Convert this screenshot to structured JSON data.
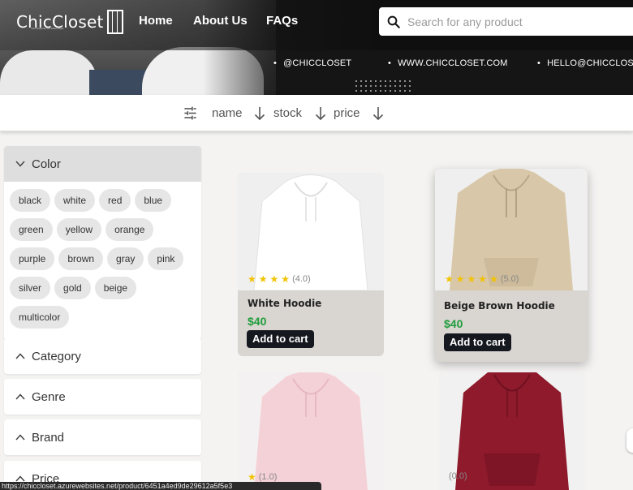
{
  "header": {
    "logo_text": "ChicCloset",
    "logo_tagline": "Your Emporium of Street Style",
    "nav": [
      "Home",
      "About Us",
      "FAQs"
    ],
    "search_placeholder": "Search for any product",
    "contacts": [
      "@CHICCLOSET",
      "WWW.CHICCLOSET.COM",
      "HELLO@CHICCLOSET"
    ]
  },
  "sort_bar": {
    "icon": "tune-icon",
    "fields": [
      {
        "label": "name",
        "icon": "arrow-down-icon"
      },
      {
        "label": "stock",
        "icon": "arrow-down-icon"
      },
      {
        "label": "price",
        "icon": "arrow-down-icon"
      }
    ]
  },
  "filters": {
    "color": {
      "title": "Color",
      "expanded": true,
      "options": [
        "black",
        "white",
        "red",
        "blue",
        "green",
        "yellow",
        "orange",
        "purple",
        "brown",
        "gray",
        "pink",
        "silver",
        "gold",
        "beige",
        "multicolor"
      ]
    },
    "collapsed": [
      "Category",
      "Genre",
      "Brand",
      "Price"
    ]
  },
  "products": [
    {
      "name": "White Hoodie",
      "price": "$40",
      "rating": "(4.0)",
      "stars": 4,
      "button": "Add to cart",
      "color": "#ffffff"
    },
    {
      "name": "Beige Brown Hoodie",
      "price": "$40",
      "rating": "(5.0)",
      "stars": 5,
      "button": "Add to cart",
      "color": "#d8c7a8"
    },
    {
      "name": "",
      "price": "",
      "rating": "(1.0)",
      "stars": 1,
      "button": "",
      "color": "#f4d1d7"
    },
    {
      "name": "",
      "price": "",
      "rating": "(0.0)",
      "stars": 0,
      "button": "",
      "color": "#8e1a2c"
    }
  ],
  "status_url": "https://chiccloset.azurewebsites.net/product/6451a4ed9de29612a5f5e3"
}
